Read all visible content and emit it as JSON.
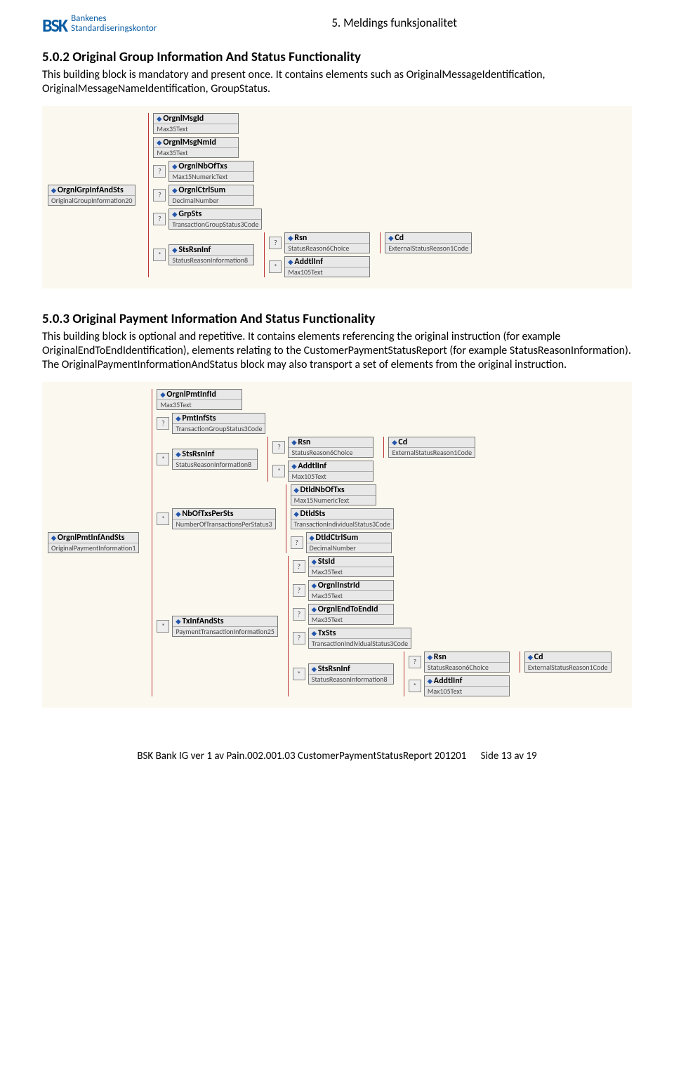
{
  "hdr": {
    "logo_top": "Bankenes",
    "logo_bot": "Standardiseringskontor",
    "logo_sym": "BSK",
    "title": "5. Meldings funksjonalitet"
  },
  "s1": {
    "h": "5.0.2 Original Group Information And Status Functionality",
    "p": "This building block is mandatory and present once. It contains elements such as OriginalMessageIdentification, OriginalMessageNameIdentification, GroupStatus."
  },
  "d1": {
    "root": {
      "name": "OrgnlGrpInfAndSts",
      "type": "OriginalGroupInformation20"
    },
    "c": [
      {
        "occ": "",
        "name": "OrgnlMsgId",
        "type": "Max35Text"
      },
      {
        "occ": "",
        "name": "OrgnlMsgNmId",
        "type": "Max35Text"
      },
      {
        "occ": "?",
        "name": "OrgnlNbOfTxs",
        "type": "Max15NumericText"
      },
      {
        "occ": "?",
        "name": "OrgnlCtrlSum",
        "type": "DecimalNumber"
      },
      {
        "occ": "?",
        "name": "GrpSts",
        "type": "TransactionGroupStatus3Code"
      },
      {
        "occ": "*",
        "name": "StsRsnInf",
        "type": "StatusReasonInformation8",
        "c": [
          {
            "occ": "?",
            "name": "Rsn",
            "type": "StatusReason6Choice",
            "c": [
              {
                "occ": "",
                "name": "Cd",
                "type": "ExternalStatusReason1Code"
              }
            ]
          },
          {
            "occ": "*",
            "name": "AddtlInf",
            "type": "Max105Text"
          }
        ]
      }
    ]
  },
  "s2": {
    "h": "5.0.3 Original Payment Information And Status Functionality",
    "p": "This building block is optional and repetitive. It contains elements referencing the original instruction (for example OriginalEndToEndIdentification), elements relating to the CustomerPaymentStatusReport (for example StatusReasonInformation). The OriginalPaymentInformationAndStatus block may also transport a set of elements from the original instruction."
  },
  "d2": {
    "root": {
      "name": "OrgnlPmtInfAndSts",
      "type": "OriginalPaymentInformation1"
    },
    "c": [
      {
        "occ": "",
        "name": "OrgnlPmtInfId",
        "type": "Max35Text"
      },
      {
        "occ": "?",
        "name": "PmtInfSts",
        "type": "TransactionGroupStatus3Code"
      },
      {
        "occ": "*",
        "name": "StsRsnInf",
        "type": "StatusReasonInformation8",
        "c": [
          {
            "occ": "?",
            "name": "Rsn",
            "type": "StatusReason6Choice",
            "c": [
              {
                "occ": "",
                "name": "Cd",
                "type": "ExternalStatusReason1Code"
              }
            ]
          },
          {
            "occ": "*",
            "name": "AddtlInf",
            "type": "Max105Text"
          }
        ]
      },
      {
        "occ": "*",
        "name": "NbOfTxsPerSts",
        "type": "NumberOfTransactionsPerStatus3",
        "c": [
          {
            "occ": "",
            "name": "DtldNbOfTxs",
            "type": "Max15NumericText"
          },
          {
            "occ": "",
            "name": "DtldSts",
            "type": "TransactionIndividualStatus3Code"
          },
          {
            "occ": "?",
            "name": "DtldCtrlSum",
            "type": "DecimalNumber"
          }
        ]
      },
      {
        "occ": "*",
        "name": "TxInfAndSts",
        "type": "PaymentTransactionInformation25",
        "c": [
          {
            "occ": "?",
            "name": "StsId",
            "type": "Max35Text"
          },
          {
            "occ": "?",
            "name": "OrgnlInstrId",
            "type": "Max35Text"
          },
          {
            "occ": "?",
            "name": "OrgnlEndToEndId",
            "type": "Max35Text"
          },
          {
            "occ": "?",
            "name": "TxSts",
            "type": "TransactionIndividualStatus3Code"
          },
          {
            "occ": "*",
            "name": "StsRsnInf",
            "type": "StatusReasonInformation8",
            "c": [
              {
                "occ": "?",
                "name": "Rsn",
                "type": "StatusReason6Choice",
                "c": [
                  {
                    "occ": "",
                    "name": "Cd",
                    "type": "ExternalStatusReason1Code"
                  }
                ]
              },
              {
                "occ": "*",
                "name": "AddtlInf",
                "type": "Max105Text"
              }
            ]
          }
        ]
      }
    ]
  },
  "ftr": {
    "left": "BSK Bank IG ver 1 av Pain.002.001.03 CustomerPaymentStatusReport 201201",
    "right": "Side 13 av 19"
  }
}
